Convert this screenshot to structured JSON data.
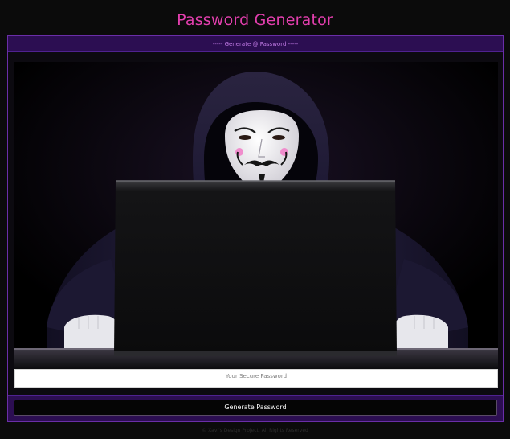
{
  "app": {
    "title": "Password Generator"
  },
  "card": {
    "header_label": "----- Generate @ Password -----"
  },
  "hero_image": {
    "description_name": "hooded-hacker-with-mask-image"
  },
  "password_field": {
    "placeholder": "Your Secure Password",
    "value": ""
  },
  "actions": {
    "generate_label": "Generate Password"
  },
  "footer": {
    "copyright": "© Xavi's Design Project. All Rights Reserved"
  },
  "colors": {
    "accent_pink": "#e33fae",
    "accent_purple": "#2c0e52",
    "border_purple": "#6a2ea8",
    "background": "#0b0b0b"
  }
}
